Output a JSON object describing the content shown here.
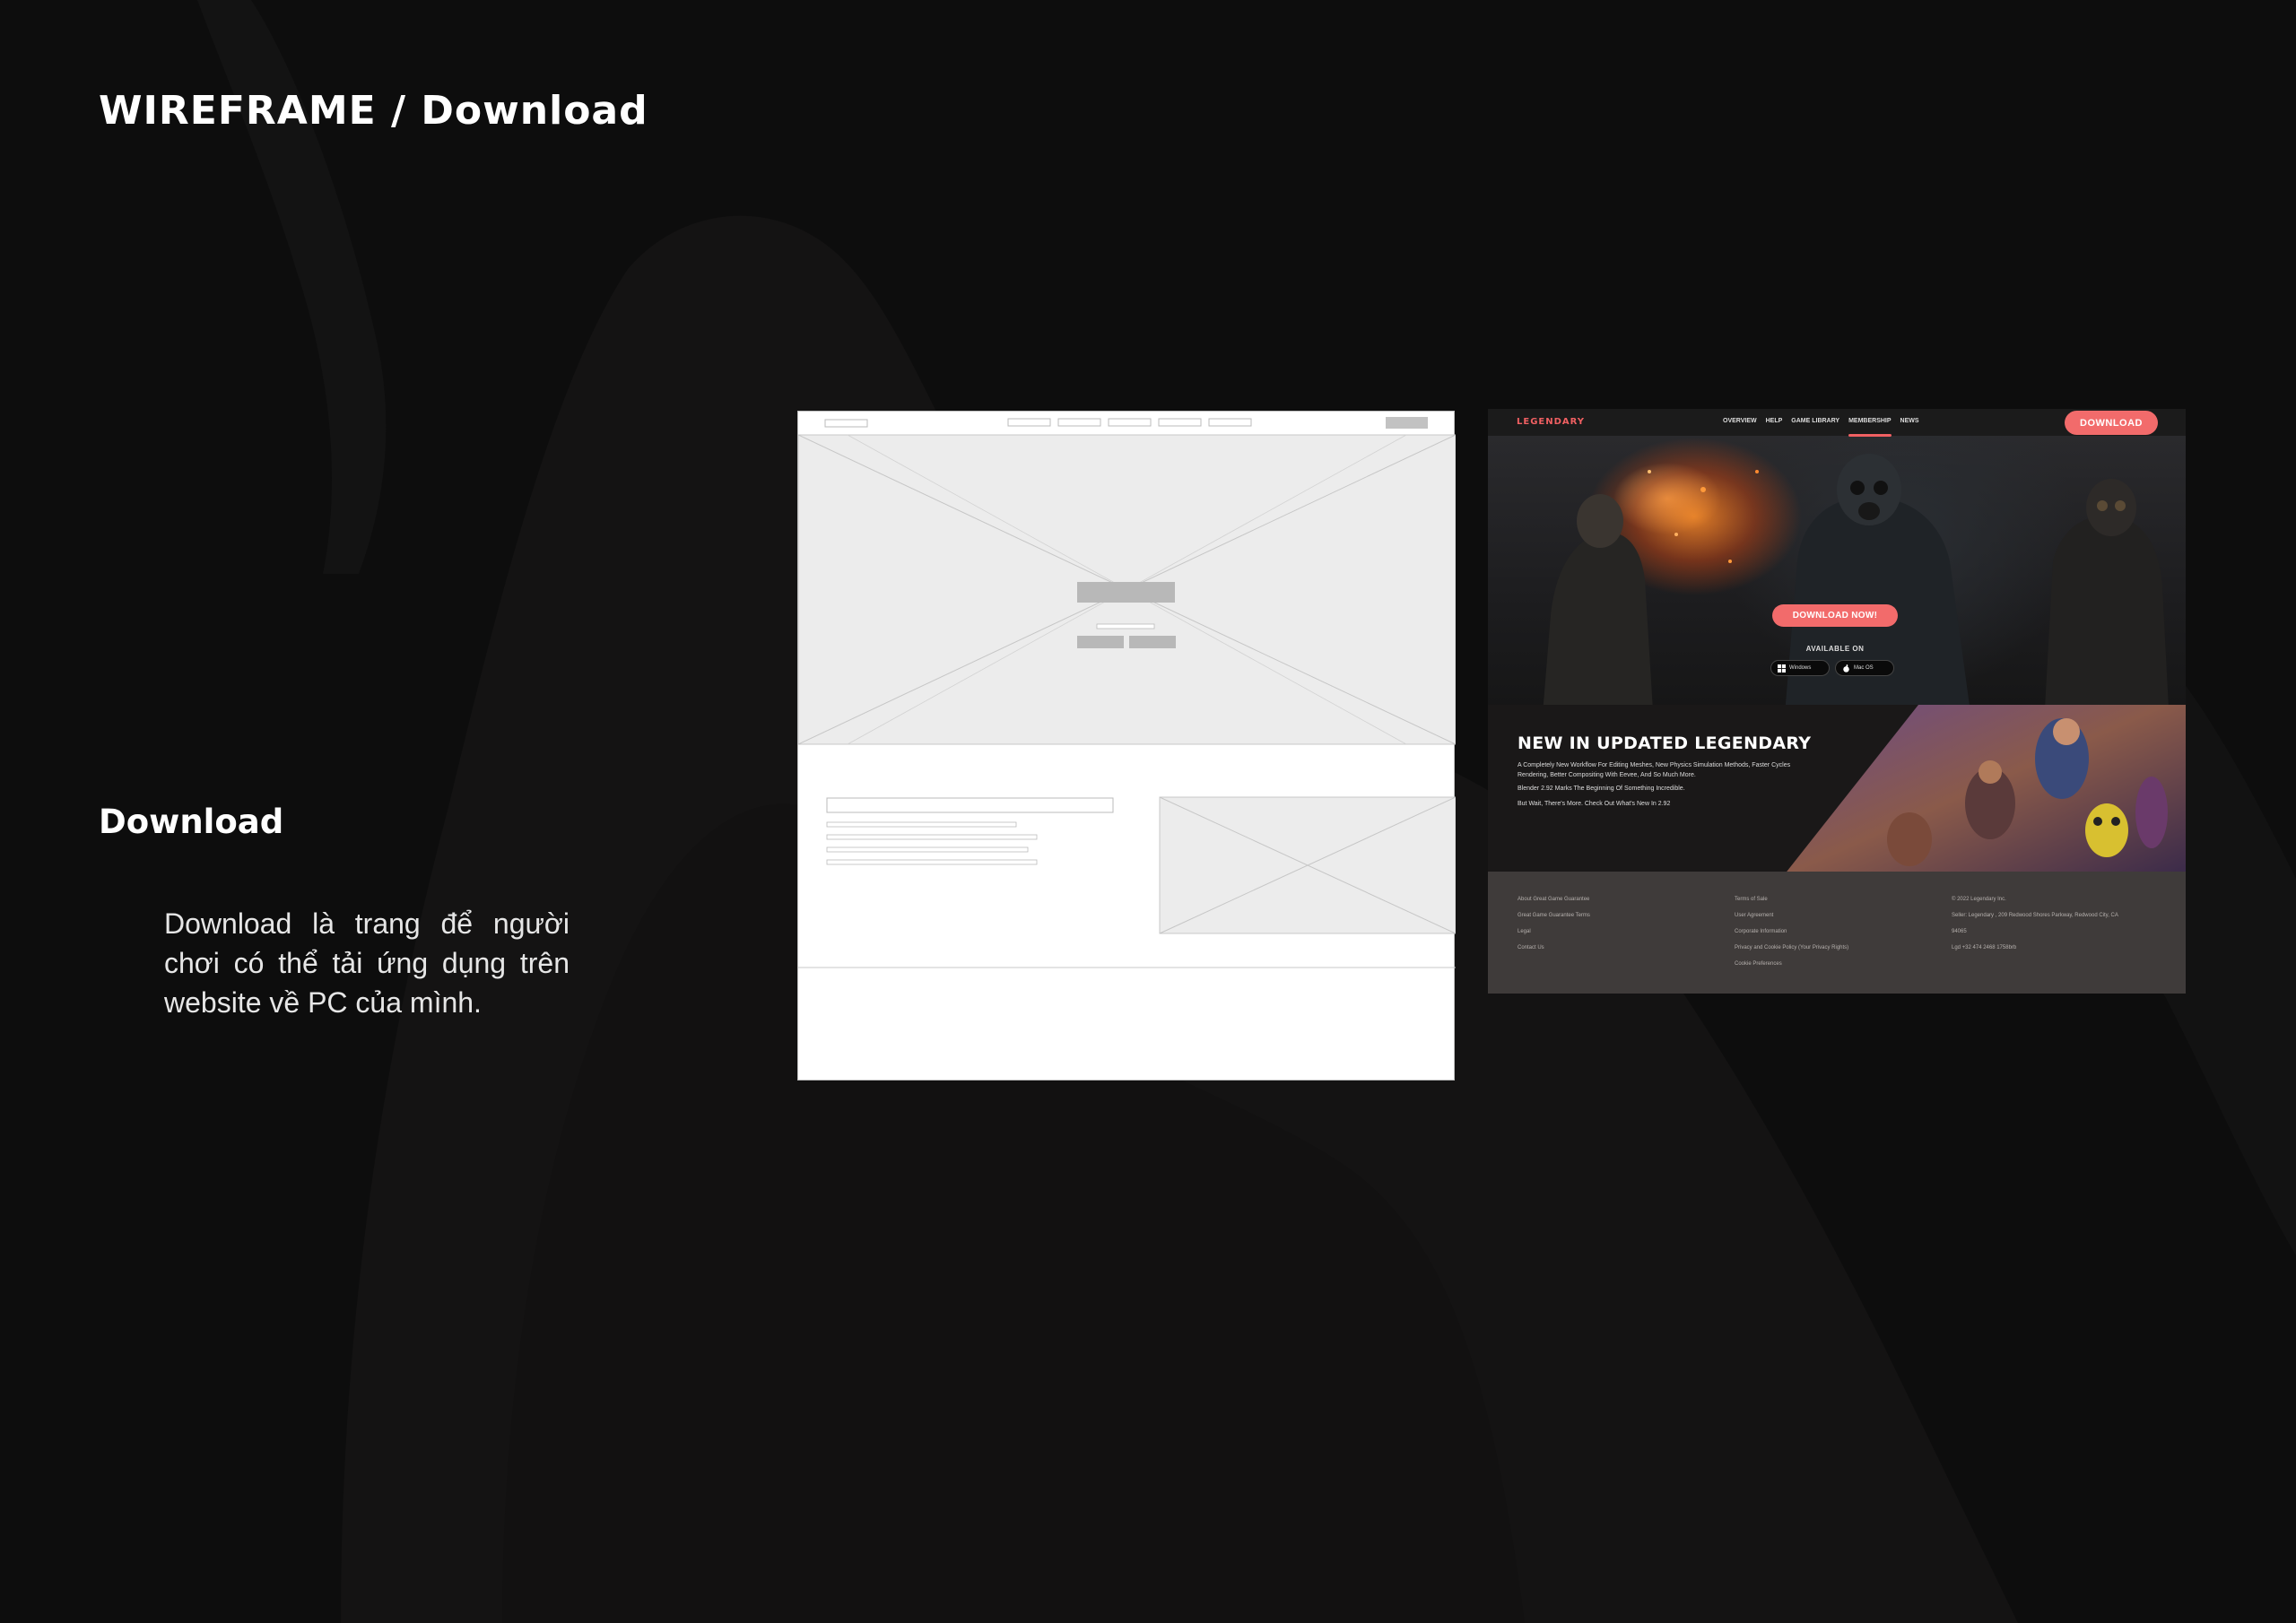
{
  "slide": {
    "title": "WIREFRAME / Download",
    "section_heading": "Download",
    "description": "Download là trang để người chơi có thể tải ứng dụng trên website về PC của mình."
  },
  "mockup": {
    "logo": "LEGENDARY",
    "nav": [
      "OVERVIEW",
      "HELP",
      "GAME LIBRARY",
      "MEMBERSHIP",
      "NEWS"
    ],
    "nav_active": "MEMBERSHIP",
    "nav_button": "DOWNLOAD",
    "hero_cta": "DOWNLOAD NOW!",
    "available_on": "AVAILABLE ON",
    "platforms": [
      "Windows",
      "Mac OS"
    ],
    "news_title": "NEW IN UPDATED LEGENDARY",
    "news_paragraphs": [
      "A Completely New Workflow For Editing Meshes, New Physics Simulation Methods, Faster Cycles Rendering, Better Compositing With Eevee, And So Much More.",
      "Blender 2.92 Marks The Beginning Of Something Incredible.",
      "But Wait, There's More. Check Out What's New In 2.92"
    ],
    "footer": {
      "col1": [
        "About Great Game Guarantee",
        "Great Game Guarantee Terms",
        "Legal",
        "Contact Us"
      ],
      "col2": [
        "Terms of Sale",
        "User Agreement",
        "Corporate Information",
        "Privacy and Cookie Policy (Your Privacy Rights)",
        "Cookie Preferences"
      ],
      "col3": [
        "© 2022 Legendary Inc.",
        "Seller: Legendary , 209 Redwood Shores Parkway, Redwood City, CA",
        "94065",
        "Lgd +32 474 2468 1758brb"
      ]
    }
  },
  "colors": {
    "background": "#0e0e0e",
    "accent": "#f26b6b",
    "footer_bg": "#3f3b3a",
    "wireframe_fill": "#ececec",
    "wireframe_stroke": "#bdbdbd"
  }
}
